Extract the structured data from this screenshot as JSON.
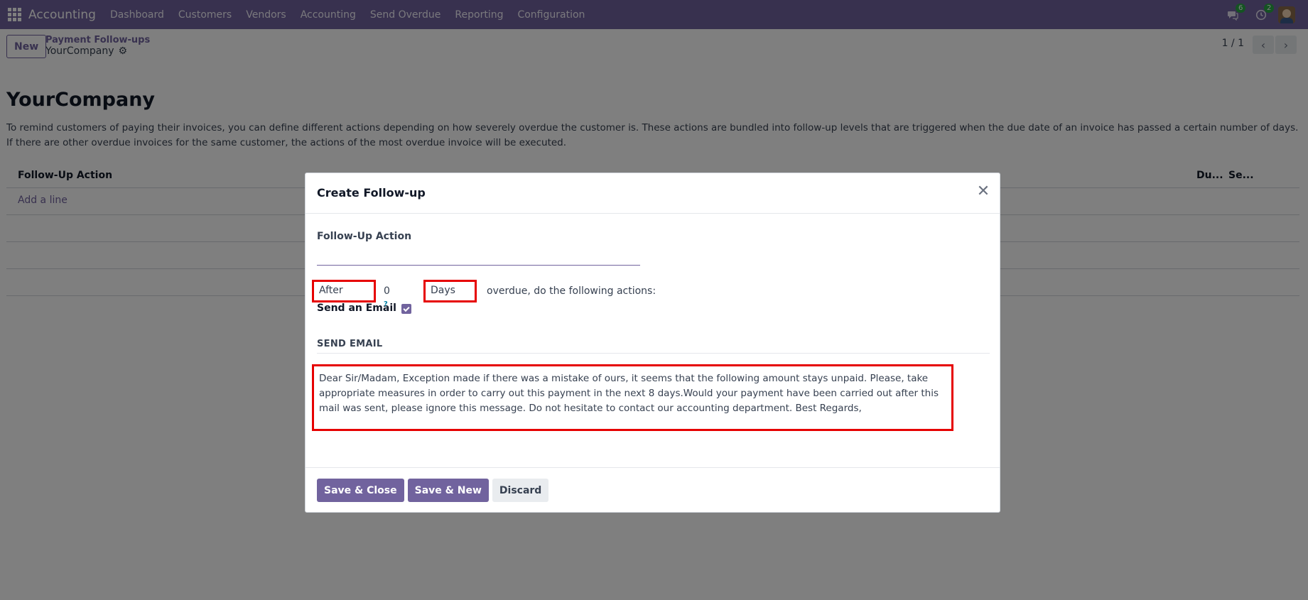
{
  "navbar": {
    "brand": "Accounting",
    "menu": [
      "Dashboard",
      "Customers",
      "Vendors",
      "Accounting",
      "Send Overdue",
      "Reporting",
      "Configuration"
    ],
    "messages_badge": "6",
    "activities_badge": "2",
    "bg_color": "#71639e"
  },
  "control_panel": {
    "new_label": "New",
    "breadcrumb_parent": "Payment Follow-ups",
    "breadcrumb_current": "YourCompany",
    "pager": "1 / 1"
  },
  "form": {
    "title": "YourCompany",
    "description": "To remind customers of paying their invoices, you can define different actions depending on how severely overdue the customer is. These actions are bundled into follow-up levels that are triggered when the due date of an invoice has passed a certain number of days. If there are other overdue invoices for the same customer, the actions of the most overdue invoice will be executed.",
    "table": {
      "headers": [
        "Follow-Up Action",
        "Du...",
        "Se..."
      ],
      "add_line": "Add a line"
    }
  },
  "modal": {
    "title": "Create Follow-up",
    "follow_up_action_label": "Follow-Up Action",
    "follow_up_action_value": "",
    "after_label": "After",
    "days_value": "0",
    "days_unit": "Days",
    "overdue_text": "overdue, do the following actions:",
    "send_email_label": "Send an Email",
    "help": "?",
    "send_email_checked": true,
    "section_title": "SEND EMAIL",
    "email_body": "Dear Sir/Madam, Exception made if there was a mistake of ours, it seems that the following amount stays unpaid. Please, take appropriate measures in order to carry out this payment in the next 8 days.Would your payment have been carried out after this mail was sent, please ignore this message. Do not hesitate to contact our accounting department. Best Regards,",
    "buttons": {
      "save_close": "Save & Close",
      "save_new": "Save & New",
      "discard": "Discard"
    }
  },
  "colors": {
    "accent": "#71639e",
    "highlight_border": "#e60000"
  }
}
